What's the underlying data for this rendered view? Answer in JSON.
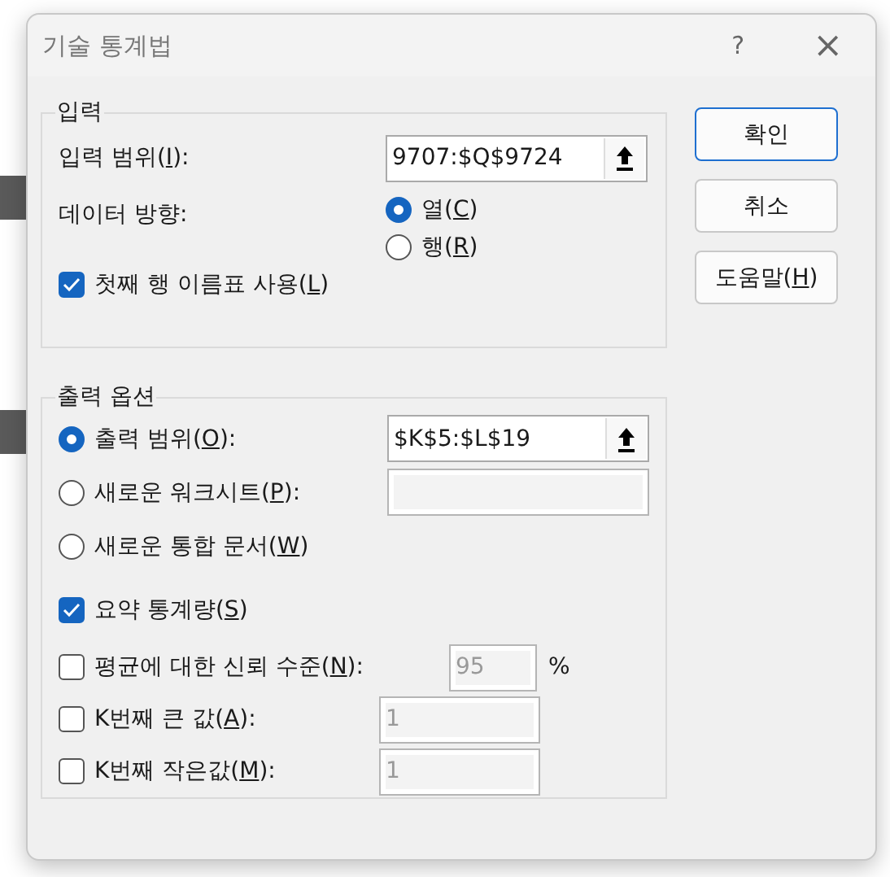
{
  "window": {
    "title": "기술 통계법",
    "help": "?",
    "close": "×"
  },
  "input_group": {
    "legend": "입력",
    "range_label": "입력 범위(I):",
    "range_value": "9707:$Q$9724",
    "direction_label": "데이터 방향:",
    "direction_options": [
      {
        "label": "열(C)",
        "selected": true
      },
      {
        "label": "행(R)",
        "selected": false
      }
    ],
    "first_row_labels": {
      "label": "첫째 행 이름표 사용(L)",
      "checked": true
    }
  },
  "output_group": {
    "legend": "출력 옵션",
    "destinations": [
      {
        "kind": "range",
        "label": "출력 범위(O):",
        "selected": true,
        "value": "$K$5:$L$19"
      },
      {
        "kind": "sheet",
        "label": "새로운 워크시트(P):",
        "selected": false
      },
      {
        "kind": "plain",
        "label": "새로운 통합 문서(W)",
        "selected": false
      }
    ],
    "options": [
      {
        "kind": "plain",
        "label": "요약 통계량(S)",
        "checked": true
      },
      {
        "kind": "percent",
        "label": "평균에 대한 신뢰 수준(N):",
        "checked": false,
        "value": "95",
        "unit": "%"
      },
      {
        "kind": "number",
        "label": "K번째 큰 값(A):",
        "checked": false,
        "value": "1"
      },
      {
        "kind": "number",
        "label": "K번째 작은값(M):",
        "checked": false,
        "value": "1"
      }
    ]
  },
  "buttons": [
    {
      "label": "확인",
      "default": true
    },
    {
      "label": "취소",
      "default": false
    },
    {
      "label": "도움말(H)",
      "default": false
    }
  ]
}
